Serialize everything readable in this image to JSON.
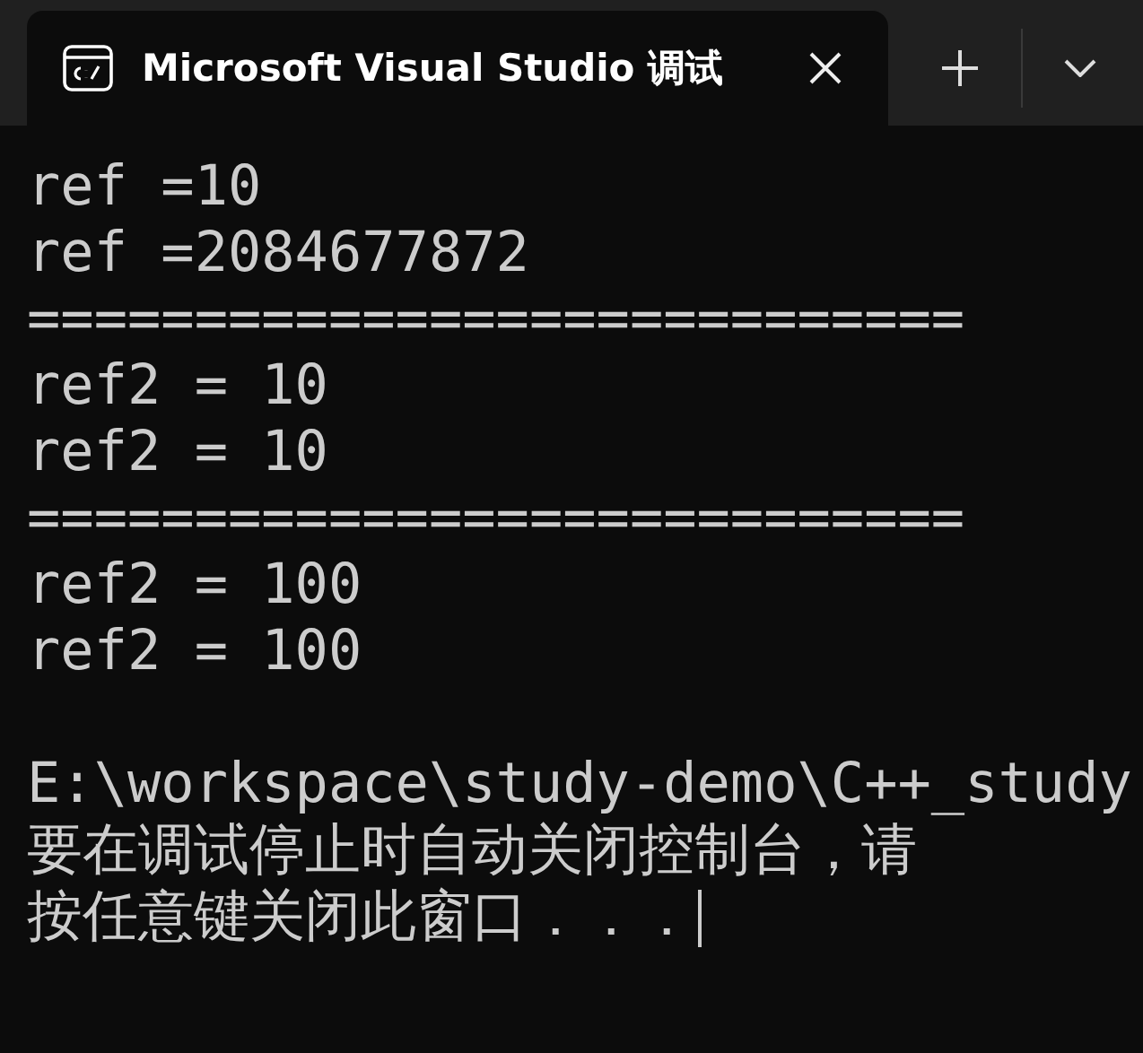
{
  "tabs": [
    {
      "title": "Microsoft Visual Studio 调试",
      "selected": true
    }
  ],
  "console": {
    "output": [
      "ref =10",
      "ref =2084677872",
      "============================",
      "ref2 = 10",
      "ref2 = 10",
      "============================",
      "ref2 = 100",
      "ref2 = 100"
    ],
    "messages": [
      "E:\\workspace\\study-demo\\C++_study",
      "要在调试停止时自动关闭控制台，请",
      "按任意键关闭此窗口．．．"
    ]
  }
}
